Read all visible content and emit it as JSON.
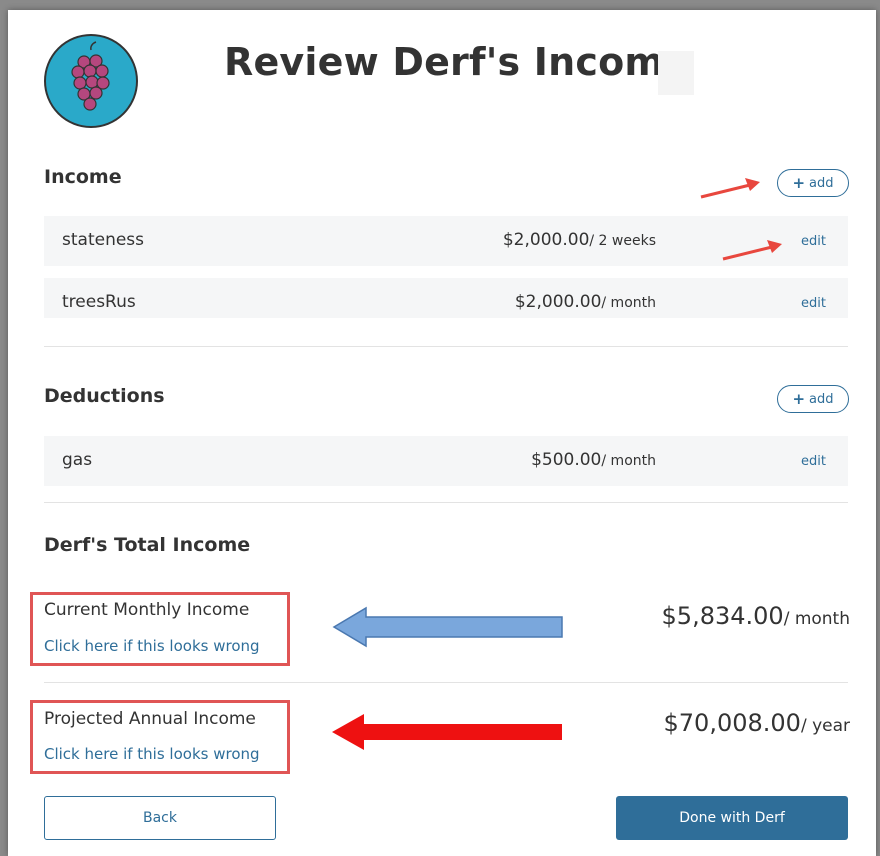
{
  "header": {
    "title": "Review Derf's Income"
  },
  "income": {
    "heading": "Income",
    "add_label": "add",
    "rows": [
      {
        "name": "stateness",
        "amount": "$2,000.00",
        "period": "/ 2 weeks",
        "edit": "edit"
      },
      {
        "name": "treesRus",
        "amount": "$2,000.00",
        "period": "/ month",
        "edit": "edit"
      }
    ]
  },
  "deductions": {
    "heading": "Deductions",
    "add_label": "add",
    "rows": [
      {
        "name": "gas",
        "amount": "$500.00",
        "period": "/ month",
        "edit": "edit"
      }
    ]
  },
  "totals": {
    "heading": "Derf's Total Income",
    "monthly": {
      "label": "Current Monthly Income",
      "link": "Click here if this looks wrong",
      "amount": "$5,834.00",
      "period": "/ month"
    },
    "annual": {
      "label": "Projected Annual Income",
      "link": "Click here if this looks wrong",
      "amount": "$70,008.00",
      "period": "/ year"
    }
  },
  "actions": {
    "back": "Back",
    "done": "Done with Derf"
  },
  "colors": {
    "accent": "#2f6e99",
    "avatar": "#2aa9c9",
    "grape": "#b5477e",
    "annotation_red": "#e8473e",
    "annotation_blue": "#7aa7dc"
  },
  "icons": {
    "avatar": "grapes-icon"
  }
}
